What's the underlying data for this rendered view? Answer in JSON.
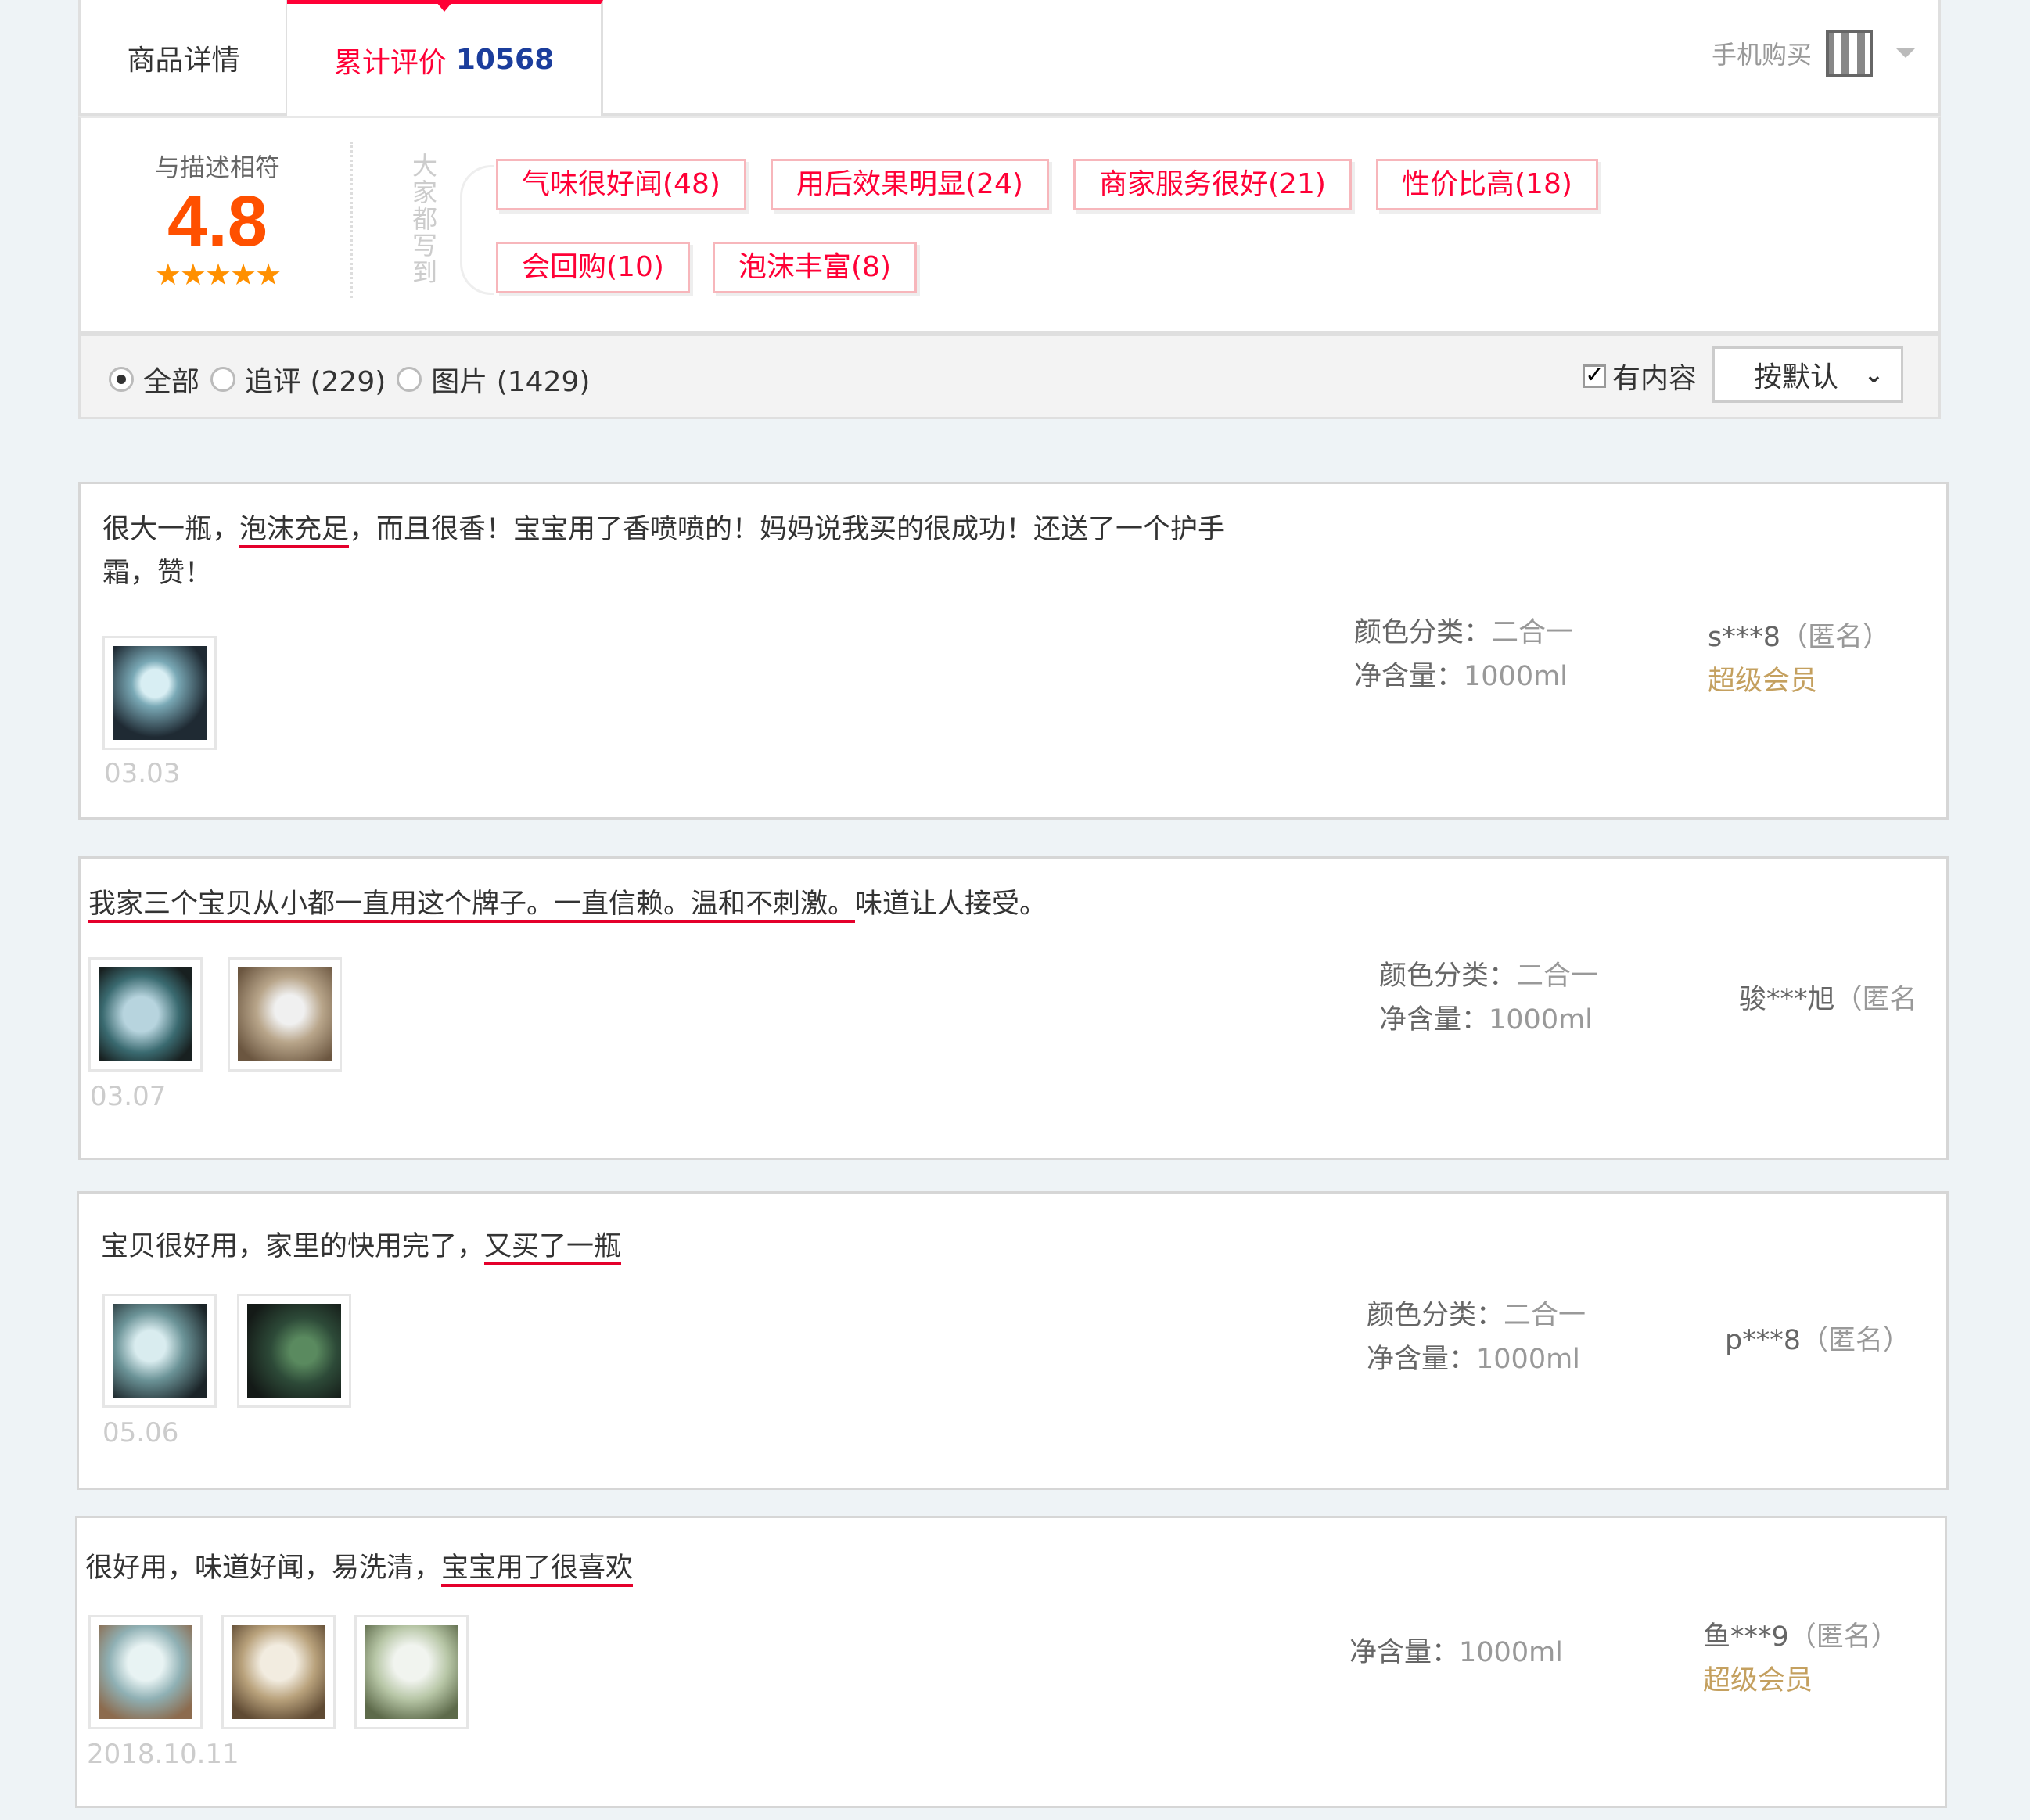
{
  "tabs": {
    "details_label": "商品详情",
    "reviews_label": "累计评价",
    "reviews_count": "10568",
    "mobile_buy": "手机购买"
  },
  "summary": {
    "score_label": "与描述相符",
    "score": "4.8",
    "stars": "★★★★★",
    "everyone_wrote": "大家都写到",
    "tags": [
      "气味很好闻(48)",
      "用后效果明显(24)",
      "商家服务很好(21)",
      "性价比高(18)",
      "会回购(10)",
      "泡沫丰富(8)"
    ]
  },
  "filter": {
    "all": "全部",
    "append": "追评 (229)",
    "pictures": "图片 (1429)",
    "has_content": "有内容",
    "sort": "按默认"
  },
  "reviews": [
    {
      "text_pre": "很大一瓶，",
      "text_ul": "泡沫充足",
      "text_post": "，而且很香！宝宝用了香喷喷的！妈妈说我买的很成功！还送了一个护手\n霜，赞！",
      "date": "03.03",
      "color_label": "颜色分类：",
      "color_value": "二合一",
      "volume_label": "净含量：",
      "volume_value": "1000ml",
      "user": "s***8",
      "anon": "（匿名）",
      "vip": "超级会员"
    },
    {
      "text_pre": "",
      "text_ul": "我家三个宝贝从小都一直用这个牌子。一直信赖。温和不刺激。",
      "text_post": "味道让人接受。",
      "date": "03.07",
      "color_label": "颜色分类：",
      "color_value": "二合一",
      "volume_label": "净含量：",
      "volume_value": "1000ml",
      "user": "骏***旭",
      "anon": "（匿名"
    },
    {
      "text_pre": "宝贝很好用，家里的快用完了，",
      "text_ul": "又买了一瓶",
      "text_post": "",
      "date": "05.06",
      "color_label": "颜色分类：",
      "color_value": "二合一",
      "volume_label": "净含量：",
      "volume_value": "1000ml",
      "user": "p***8",
      "anon": "（匿名）"
    },
    {
      "text_pre": "很好用，味道好闻，易洗清，",
      "text_ul": "宝宝用了很喜欢",
      "text_post": "",
      "date": "2018.10.11",
      "volume_label": "净含量：",
      "volume_value": "1000ml",
      "user": "鱼***9",
      "anon": "（匿名）",
      "vip": "超级会员"
    }
  ],
  "colors": {
    "accent": "#ff0036",
    "score": "#ff5000",
    "count_blue": "#1b3d9c",
    "vip": "#c4a05f"
  }
}
